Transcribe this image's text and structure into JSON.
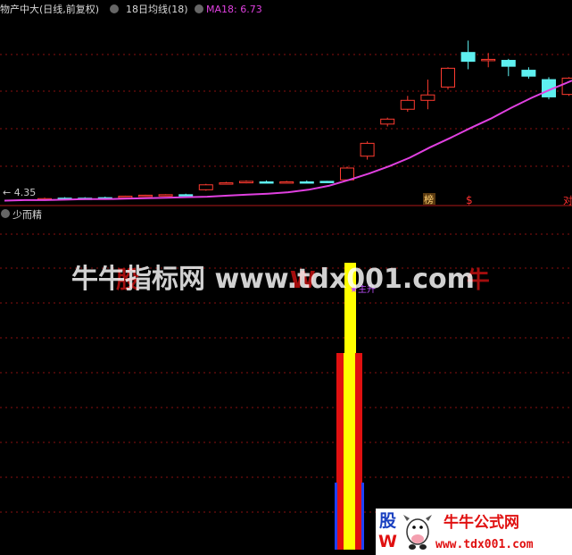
{
  "header": {
    "title": "物产中大(日线,前复权)",
    "indicator": "18日均线(18)",
    "ma_label": "MA18: 6.73"
  },
  "sub_panel": {
    "title": "少而精"
  },
  "annotations": {
    "low_price": "← 4.35",
    "tag_bang": "榜",
    "tag_s": "$",
    "tag_right": "对",
    "signal": "★主升"
  },
  "watermark": {
    "text": "牛牛指标网 www.tdx001.com",
    "ghost": "股 W 牛 com"
  },
  "logo": {
    "left_top": "股",
    "left_bottom": "W",
    "title": "牛牛公式网",
    "url": "www.tdx001.com"
  },
  "colors": {
    "background": "#000000",
    "up": "#ff3b30",
    "down": "#5ef0f0",
    "ma": "#e040e0",
    "grid": "#8a1010",
    "bar_red": "#e01010",
    "bar_yellow": "#ffff00",
    "bar_blue": "#2040ff"
  },
  "chart_data": {
    "type": "candlestick",
    "ma_period": 18,
    "ma_last": 6.73,
    "low_marker": 4.35,
    "ylim": [
      4.2,
      8.0
    ],
    "candles": [
      {
        "o": 4.33,
        "h": 4.36,
        "l": 4.31,
        "c": 4.34,
        "up": true
      },
      {
        "o": 4.35,
        "h": 4.37,
        "l": 4.34,
        "c": 4.35,
        "up": false
      },
      {
        "o": 4.35,
        "h": 4.37,
        "l": 4.33,
        "c": 4.35,
        "up": false
      },
      {
        "o": 4.36,
        "h": 4.38,
        "l": 4.34,
        "c": 4.36,
        "up": false
      },
      {
        "o": 4.36,
        "h": 4.4,
        "l": 4.35,
        "c": 4.39,
        "up": true
      },
      {
        "o": 4.39,
        "h": 4.42,
        "l": 4.38,
        "c": 4.41,
        "up": true
      },
      {
        "o": 4.41,
        "h": 4.43,
        "l": 4.4,
        "c": 4.42,
        "up": true
      },
      {
        "o": 4.42,
        "h": 4.44,
        "l": 4.41,
        "c": 4.42,
        "up": false
      },
      {
        "o": 4.52,
        "h": 4.64,
        "l": 4.5,
        "c": 4.62,
        "up": true
      },
      {
        "o": 4.65,
        "h": 4.68,
        "l": 4.64,
        "c": 4.66,
        "up": true
      },
      {
        "o": 4.66,
        "h": 4.71,
        "l": 4.65,
        "c": 4.69,
        "up": true
      },
      {
        "o": 4.68,
        "h": 4.71,
        "l": 4.66,
        "c": 4.67,
        "up": false
      },
      {
        "o": 4.67,
        "h": 4.7,
        "l": 4.65,
        "c": 4.68,
        "up": true
      },
      {
        "o": 4.68,
        "h": 4.71,
        "l": 4.66,
        "c": 4.67,
        "up": false
      },
      {
        "o": 4.68,
        "h": 4.7,
        "l": 4.66,
        "c": 4.69,
        "up": false
      },
      {
        "o": 4.72,
        "h": 4.99,
        "l": 4.7,
        "c": 4.96,
        "up": true
      },
      {
        "o": 5.2,
        "h": 5.5,
        "l": 5.13,
        "c": 5.46,
        "up": true
      },
      {
        "o": 5.85,
        "h": 5.98,
        "l": 5.8,
        "c": 5.95,
        "up": true
      },
      {
        "o": 6.15,
        "h": 6.42,
        "l": 6.1,
        "c": 6.33,
        "up": true
      },
      {
        "o": 6.33,
        "h": 6.75,
        "l": 6.15,
        "c": 6.44,
        "up": true
      },
      {
        "o": 6.6,
        "h": 7.0,
        "l": 6.55,
        "c": 6.98,
        "up": true
      },
      {
        "o": 7.3,
        "h": 7.54,
        "l": 6.96,
        "c": 7.12,
        "up": false
      },
      {
        "o": 7.15,
        "h": 7.29,
        "l": 7.0,
        "c": 7.16,
        "up": true
      },
      {
        "o": 7.14,
        "h": 7.17,
        "l": 6.82,
        "c": 7.02,
        "up": false
      },
      {
        "o": 6.94,
        "h": 7.0,
        "l": 6.77,
        "c": 6.82,
        "up": false
      },
      {
        "o": 6.75,
        "h": 6.8,
        "l": 6.35,
        "c": 6.4,
        "up": false
      },
      {
        "o": 6.45,
        "h": 6.8,
        "l": 6.42,
        "c": 6.78,
        "up": true
      },
      {
        "o": 7.3,
        "h": 7.52,
        "l": 7.2,
        "c": 7.48,
        "up": true
      }
    ],
    "ma": [
      4.3,
      4.31,
      4.31,
      4.32,
      4.33,
      4.33,
      4.34,
      4.35,
      4.36,
      4.37,
      4.38,
      4.4,
      4.42,
      4.44,
      4.47,
      4.52,
      4.6,
      4.72,
      4.85,
      5.0,
      5.17,
      5.38,
      5.57,
      5.77,
      5.96,
      6.18,
      6.38,
      6.56,
      6.73
    ]
  }
}
